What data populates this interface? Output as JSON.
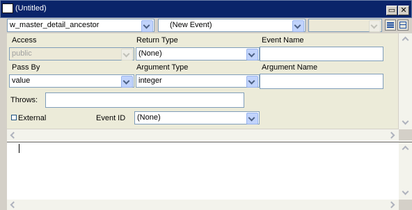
{
  "window": {
    "title": "(Untitled)",
    "minimize_glyph": "▭",
    "close_glyph": "✕"
  },
  "toolbar": {
    "object_select": "w_master_detail_ancestor",
    "event_select": "(New Event)",
    "third_select": ""
  },
  "form": {
    "access_label": "Access",
    "access_value": "public",
    "return_type_label": "Return Type",
    "return_type_value": "(None)",
    "event_name_label": "Event Name",
    "event_name_value": "",
    "pass_by_label": "Pass By",
    "pass_by_value": "value",
    "argument_type_label": "Argument Type",
    "argument_type_value": "integer",
    "argument_name_label": "Argument Name",
    "argument_name_value": "",
    "throws_label": "Throws:",
    "throws_value": "",
    "external_label": "External",
    "event_id_label": "Event ID",
    "event_id_value": "(None)"
  },
  "editor": {
    "content": ""
  },
  "colors": {
    "titlebar": "#0a246a",
    "panel": "#ecebd9",
    "dropdown_button": "#c1d3fb"
  }
}
